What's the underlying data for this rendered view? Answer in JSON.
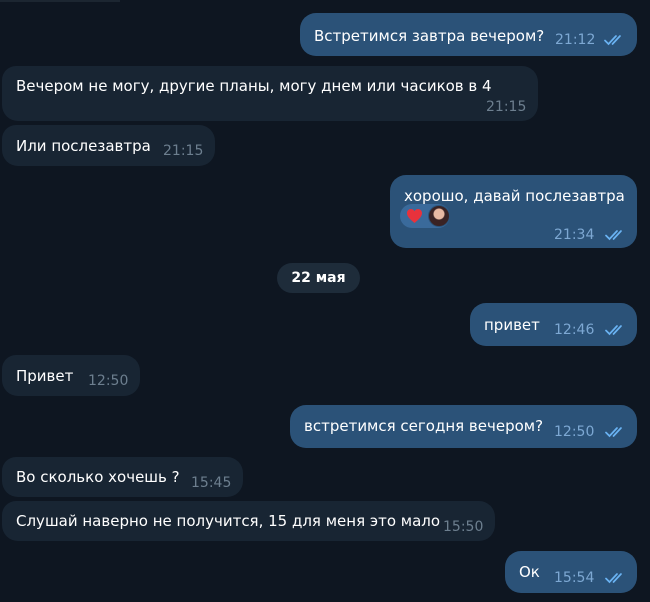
{
  "colors": {
    "background": "#0e1621",
    "incoming_bubble": "#182533",
    "outgoing_bubble": "#2b5278",
    "outgoing_time": "#7da8d3",
    "incoming_time": "#6d7f8f",
    "read_ticks": "#6ab3f3"
  },
  "date_separator": "22 мая",
  "messages": [
    {
      "text": "Встретимся завтра вечером?",
      "time": "21:12",
      "direction": "out",
      "read": true
    },
    {
      "text": "Вечером не могу, другие планы, могу днем или часиков в 4",
      "time": "21:15",
      "direction": "in"
    },
    {
      "text": "Или послезавтра",
      "time": "21:15",
      "direction": "in"
    },
    {
      "text": "хорошо, давай послезавтра",
      "time": "21:34",
      "direction": "out",
      "read": true,
      "reactions": [
        "heart-icon",
        "reactor-avatar"
      ]
    },
    {
      "text": "привет",
      "time": "12:46",
      "direction": "out",
      "read": true
    },
    {
      "text": "Привет",
      "time": "12:50",
      "direction": "in"
    },
    {
      "text": "встретимся сегодня вечером?",
      "time": "12:50",
      "direction": "out",
      "read": true
    },
    {
      "text": "Во сколько хочешь ?",
      "time": "15:45",
      "direction": "in"
    },
    {
      "text": "Слушай наверно не получится, 15 для меня это мало",
      "time": "15:50",
      "direction": "in"
    },
    {
      "text": "Ок",
      "time": "15:54",
      "direction": "out",
      "read": true
    }
  ]
}
